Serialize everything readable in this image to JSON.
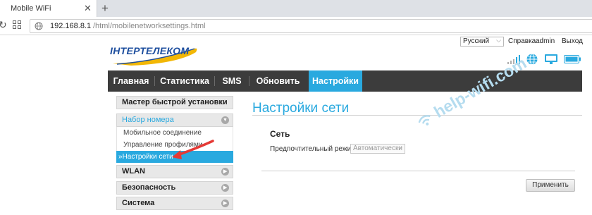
{
  "browser": {
    "tab_title": "Mobile WiFi",
    "tab_close": "✕",
    "new_tab": "+",
    "reload": "↻",
    "url_host": "192.168.8.1",
    "url_path": "/html/mobilenetworksettings.html"
  },
  "header": {
    "logo_text": "ІНТЕРТЕЛЕКОМ",
    "language_selected": "Русский",
    "help_label": "Справка",
    "user_label": "admin",
    "logout_label": "Выход"
  },
  "nav": {
    "items": [
      "Главная",
      "Статистика",
      "SMS",
      "Обновить",
      "Настройки"
    ],
    "active_index": 4
  },
  "sidebar": {
    "quick_setup": "Мастер быстрой установки",
    "dialup": "Набор номера",
    "dialup_items": [
      "Мобильное соединение",
      "Управление профилями",
      "Настройки сети"
    ],
    "active_subitem_prefix": "»",
    "wlan": "WLAN",
    "security": "Безопасность",
    "system": "Система"
  },
  "content": {
    "title": "Настройки сети",
    "section": "Сеть",
    "preferred_mode_label": "Предпочтительный режим:",
    "preferred_mode_value": "Автоматически",
    "apply_label": "Применить"
  },
  "watermark": "help-wifi.com",
  "colors": {
    "accent": "#29a9df",
    "navbar": "#3c3c3c",
    "logo_blue": "#1d4e9e",
    "logo_yellow": "#f2b705"
  },
  "icons": [
    "reload-icon",
    "apps-grid-icon",
    "globe-icon",
    "signal-icon",
    "network-globe-icon",
    "monitor-icon",
    "battery-icon",
    "red-arrow-annotation"
  ]
}
